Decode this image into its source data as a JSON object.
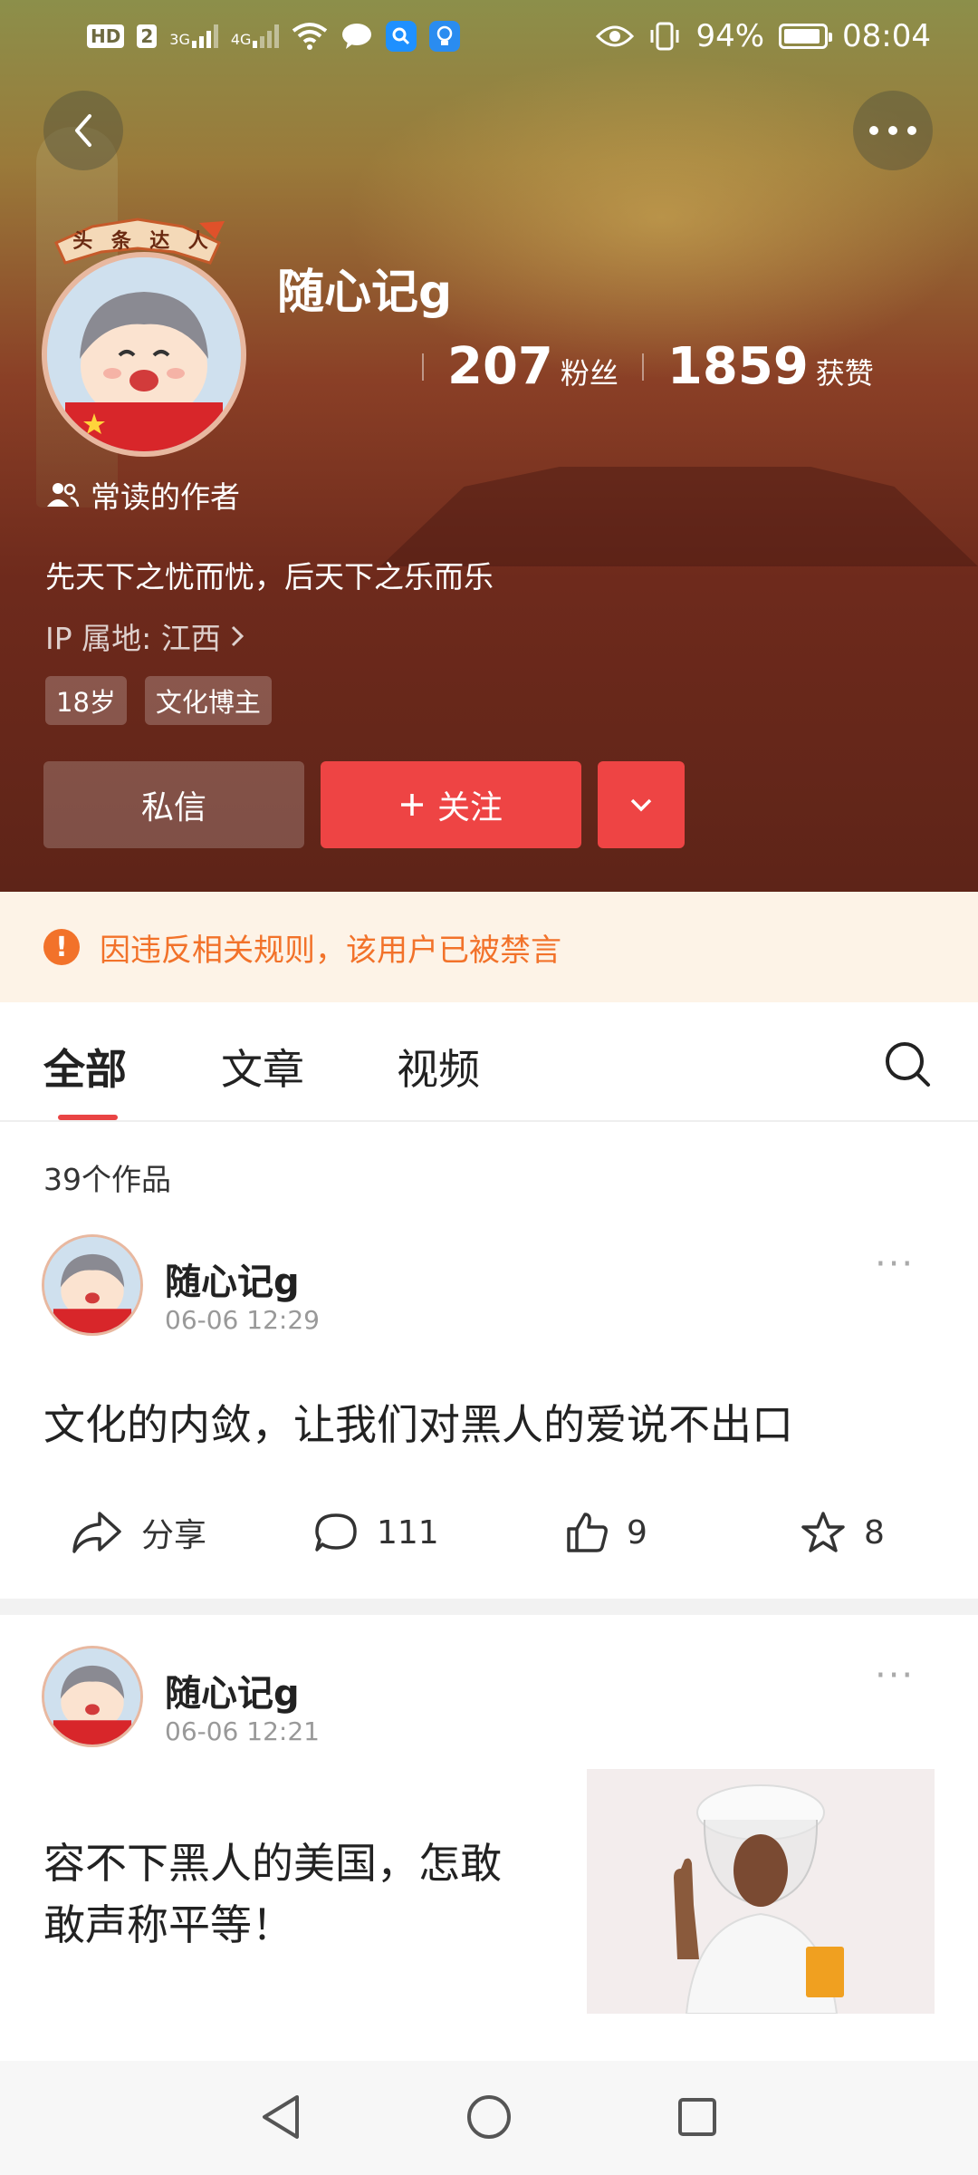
{
  "status_bar": {
    "left_icons": [
      "hd-icon",
      "sim2-icon",
      "signal-3g-icon",
      "signal-4g-icon",
      "wifi-icon",
      "chat-app-icon",
      "search-app-icon",
      "bulb-app-icon"
    ],
    "hd": "HD",
    "sim": "2",
    "net1": "3G",
    "net2": "4G",
    "battery_pct": "94%",
    "battery_level": 0.94,
    "time": "08:04"
  },
  "profile": {
    "name": "随心记g",
    "badge_text": "头条达人",
    "fans_count": "207",
    "fans_label": "粉丝",
    "likes_count": "1859",
    "likes_label": "获赞",
    "frequent_label": "常读的作者",
    "bio": "先天下之忧而忧，后天下之乐而乐",
    "ip": "IP 属地: 江西",
    "tags": [
      "18岁",
      "文化博主"
    ]
  },
  "actions": {
    "message": "私信",
    "follow": "关注"
  },
  "notice": {
    "text": "因违反相关规则，该用户已被禁言",
    "color": "#f2722a"
  },
  "tabs": {
    "items": [
      "全部",
      "文章",
      "视频"
    ],
    "active": 0,
    "accent": "#e94444"
  },
  "works_count": "39个作品",
  "posts": [
    {
      "author": "随心记g",
      "time": "06-06 12:29",
      "text": "文化的内敛，让我们对黑人的爱说不出口",
      "share_label": "分享",
      "comments": "111",
      "likes": "9",
      "favorites": "8"
    },
    {
      "author": "随心记g",
      "time": "06-06 12:21",
      "text_line1": "容不下黑人的美国，怎敢",
      "text_line2": "敢声称平等！",
      "has_image": true
    }
  ],
  "colors": {
    "brand_red": "#ee4444",
    "notice_bg": "#fdf3e7"
  }
}
